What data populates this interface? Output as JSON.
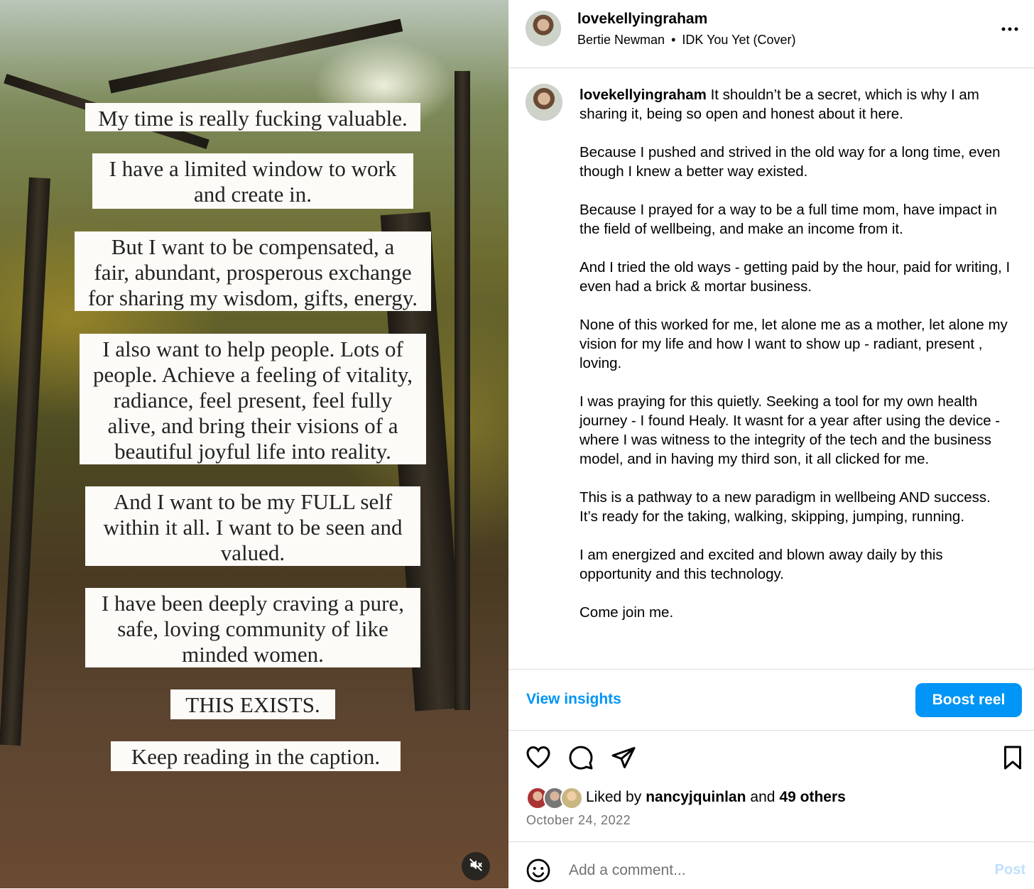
{
  "media": {
    "text_cards": [
      "My time is really fucking valuable.",
      "I have a limited window to work\nand create in.",
      "But I want to be compensated, a\nfair, abundant, prosperous exchange\nfor sharing my wisdom, gifts, energy.",
      "I also want to help people. Lots of\npeople. Achieve a feeling of vitality,\nradiance, feel present, feel fully\nalive, and bring their visions of a\nbeautiful joyful life into reality.",
      "And I want to be my FULL self\nwithin it all. I want to be seen and\nvalued.",
      "I have been deeply craving a pure,\nsafe, loving community of like\nminded women.",
      "THIS EXISTS.",
      "Keep reading in the caption."
    ],
    "mute_icon": "speaker-muted-icon"
  },
  "header": {
    "username": "lovekellyingraham",
    "audio_artist": "Bertie Newman",
    "audio_separator": "•",
    "audio_title": "IDK You Yet (Cover)",
    "more_icon": "more-options-icon"
  },
  "caption": {
    "username": "lovekellyingraham",
    "first_line": "It shouldn’t be a secret, which is why I am sharing it, being so open and honest about it here.",
    "paragraphs": [
      "Because I pushed and strived in the old way for a long time, even though I knew a better way existed.",
      "Because I prayed for a way to be a full time mom, have impact in the field of wellbeing, and make an income from it.",
      "And I tried the old ways - getting paid by the hour, paid for writing, I even had a brick & mortar business.",
      "None of this worked for me, let alone me as a mother, let alone my vision for my life and how I want to show up - radiant, present , loving.",
      "I was praying for this quietly. Seeking a tool for my own health journey - I found Healy. It wasnt for a year after using the device - where I was witness to the integrity of the tech and the business model, and in having my third son, it all clicked for me.",
      "This is a pathway to a new paradigm in wellbeing AND success. It’s ready for the taking, walking, skipping, jumping, running.",
      "I am energized and excited and blown away daily by this opportunity and this technology.",
      "Come join me."
    ]
  },
  "actions": {
    "view_insights": "View insights",
    "boost": "Boost reel",
    "icons": [
      "heart-icon",
      "comment-icon",
      "share-icon",
      "bookmark-icon"
    ]
  },
  "likes": {
    "prefix": "Liked by",
    "user": "nancyjquinlan",
    "middle": "and",
    "others": "49 others"
  },
  "date": "October 24, 2022",
  "comment": {
    "placeholder": "Add a comment...",
    "post": "Post",
    "emoji_icon": "emoji-icon"
  }
}
